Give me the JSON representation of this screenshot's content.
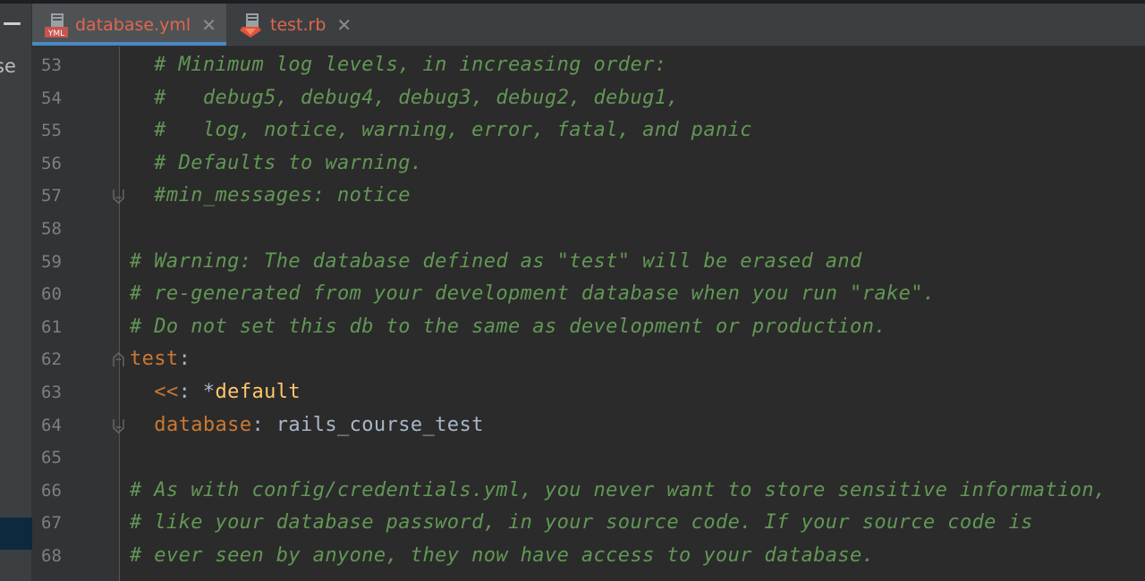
{
  "tabs": [
    {
      "label": "database.yml",
      "icon": "yaml-file-icon",
      "active": true
    },
    {
      "label": "test.rb",
      "icon": "ruby-file-icon",
      "active": false
    }
  ],
  "sidebar": {
    "clipped_text": "se"
  },
  "colors": {
    "background": "#2b2b2b",
    "gutter": "#313335",
    "comment": "#629755",
    "key": "#cc7832",
    "anchor": "#ffc66d",
    "text": "#a9b7c6",
    "tab_label": "#e2664e",
    "active_tab_underline": "#4a88c7"
  },
  "editor": {
    "lines": [
      {
        "number": "53",
        "comment": "  # Minimum log levels, in increasing order:"
      },
      {
        "number": "54",
        "comment": "  #   debug5, debug4, debug3, debug2, debug1,"
      },
      {
        "number": "55",
        "comment": "  #   log, notice, warning, error, fatal, and panic"
      },
      {
        "number": "56",
        "comment": "  # Defaults to warning."
      },
      {
        "number": "57",
        "comment": "  #min_messages: notice"
      },
      {
        "number": "58",
        "comment": ""
      },
      {
        "number": "59",
        "comment": "# Warning: The database defined as \"test\" will be erased and"
      },
      {
        "number": "60",
        "comment": "# re-generated from your development database when you run \"rake\"."
      },
      {
        "number": "61",
        "comment": "# Do not set this db to the same as development or production."
      },
      {
        "number": "62",
        "key": "test",
        "sep": ":"
      },
      {
        "number": "63",
        "indent": "  ",
        "key": "<<",
        "sep": ": *",
        "anchor": "default"
      },
      {
        "number": "64",
        "indent": "  ",
        "key": "database",
        "sep": ": ",
        "value": "rails_course_test"
      },
      {
        "number": "65",
        "comment": ""
      },
      {
        "number": "66",
        "comment": "# As with config/credentials.yml, you never want to store sensitive information,"
      },
      {
        "number": "67",
        "comment": "# like your database password, in your source code. If your source code is"
      },
      {
        "number": "68",
        "comment": "# ever seen by anyone, they now have access to your database."
      }
    ]
  }
}
